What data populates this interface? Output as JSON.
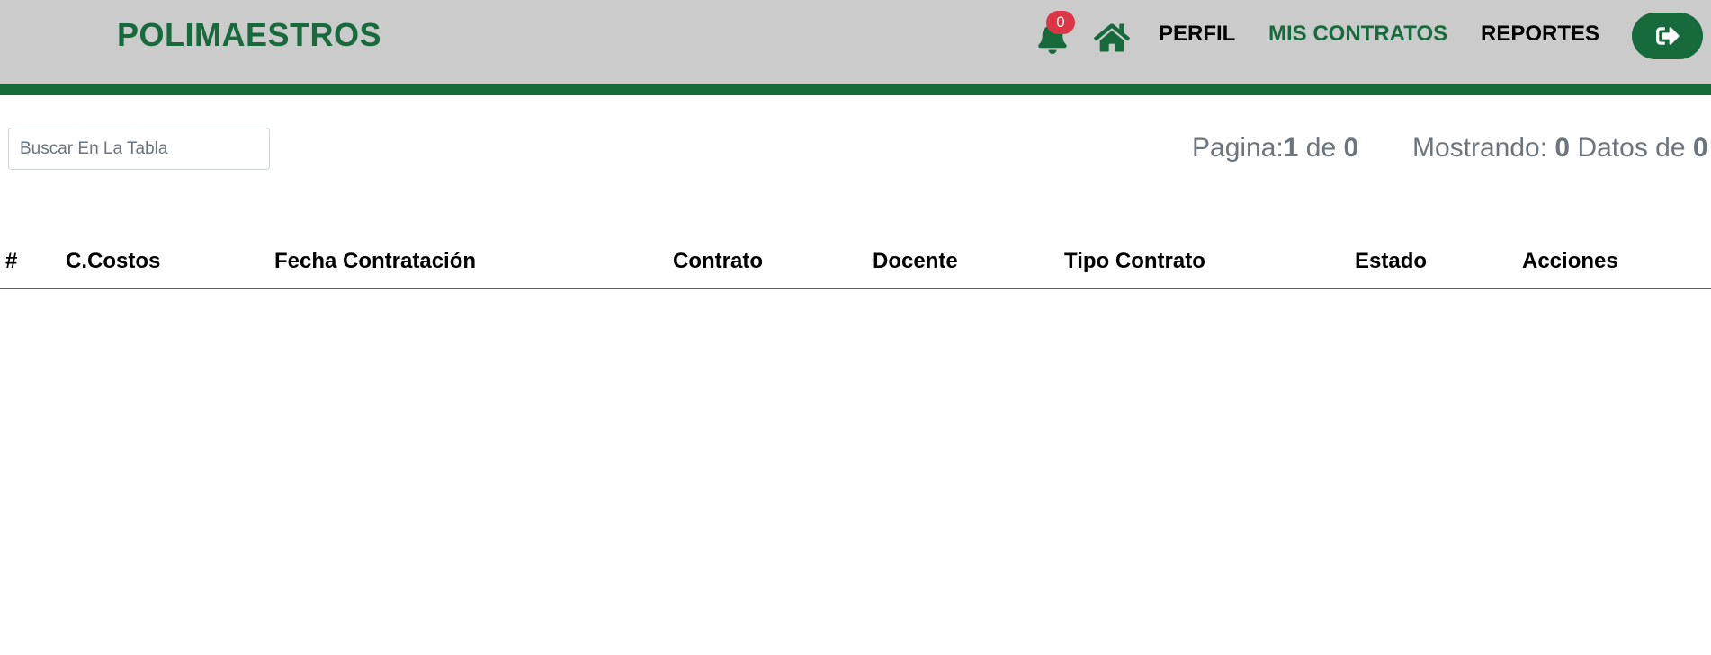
{
  "header": {
    "brand": "POLIMAESTROS",
    "notification_count": "0",
    "nav": {
      "perfil": "PERFIL",
      "mis_contratos": "MIS CONTRATOS",
      "reportes": "REPORTES"
    },
    "icons": {
      "notifications": "bell-icon",
      "home": "home-icon",
      "logout": "sign-out-icon"
    }
  },
  "toolbar": {
    "search_placeholder": "Buscar En La Tabla",
    "search_value": "",
    "page_label": "Pagina:",
    "page_current": "1",
    "page_of": "de",
    "page_total": "0",
    "showing_label": "Mostrando:",
    "showing_count": "0",
    "showing_of": "Datos de",
    "showing_total": "0"
  },
  "table": {
    "columns": [
      "#",
      "C.Costos",
      "Fecha Contratación",
      "Contrato",
      "Docente",
      "Tipo Contrato",
      "Estado",
      "Acciones"
    ],
    "rows": []
  },
  "colors": {
    "brand_green": "#176a3b",
    "header_bg": "#cbcbcb",
    "badge_red": "#dc3545",
    "muted_text": "#6c757d"
  }
}
